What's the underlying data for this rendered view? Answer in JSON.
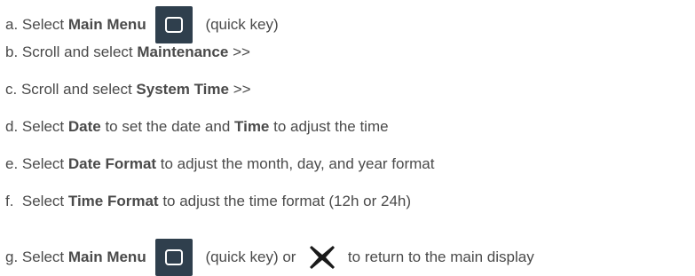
{
  "steps": [
    {
      "prefix": "a. Select ",
      "bold": "Main Menu",
      "suffix": " (quick key)"
    },
    {
      "prefix": "b. Scroll and select ",
      "bold": "Maintenance",
      "suffix": " >>"
    },
    {
      "prefix": "c. Scroll and select ",
      "bold": "System Time",
      "suffix": " >>"
    },
    {
      "prefix": "d. Select ",
      "bold1": "Date",
      "mid": " to set the date and ",
      "bold2": "Time",
      "suffix": " to adjust the time"
    },
    {
      "prefix": "e. Select ",
      "bold": "Date Format",
      "suffix": " to adjust the month, day, and year format"
    },
    {
      "prefix": "f.  Select ",
      "bold": "Time Format",
      "suffix": " to adjust the time format (12h or 24h)"
    },
    {
      "prefix": "g. Select ",
      "bold": "Main Menu",
      "mid": " (quick key) or ",
      "suffix": " to return to the main display"
    }
  ],
  "icons": {
    "main_menu_key": "main-menu-key-icon",
    "close": "close-x-icon"
  },
  "colors": {
    "text": "#4a4a4a",
    "key_background": "#2f3f4d",
    "key_symbol": "#ffffff",
    "x_icon": "#1a1a1a"
  }
}
